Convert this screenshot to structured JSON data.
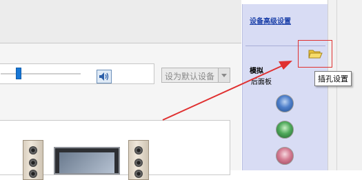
{
  "main": {
    "default_device_label": "设为默认设备"
  },
  "sidebar": {
    "advanced_link": "设备高级设置",
    "analog_label": "模拟",
    "rear_panel_label": "后面板",
    "jack_colors": [
      "#4e7fca",
      "#4fa95a",
      "#d47c92"
    ]
  },
  "tooltip": {
    "text": "插孔设置"
  },
  "volume": {
    "level": 0.22
  },
  "icons": {
    "speaker": "speaker-icon",
    "folder": "folder-icon"
  },
  "colors": {
    "annotation": "#e03030",
    "sidebar_bg": "#d8dcf4",
    "link": "#1a3fa8"
  }
}
